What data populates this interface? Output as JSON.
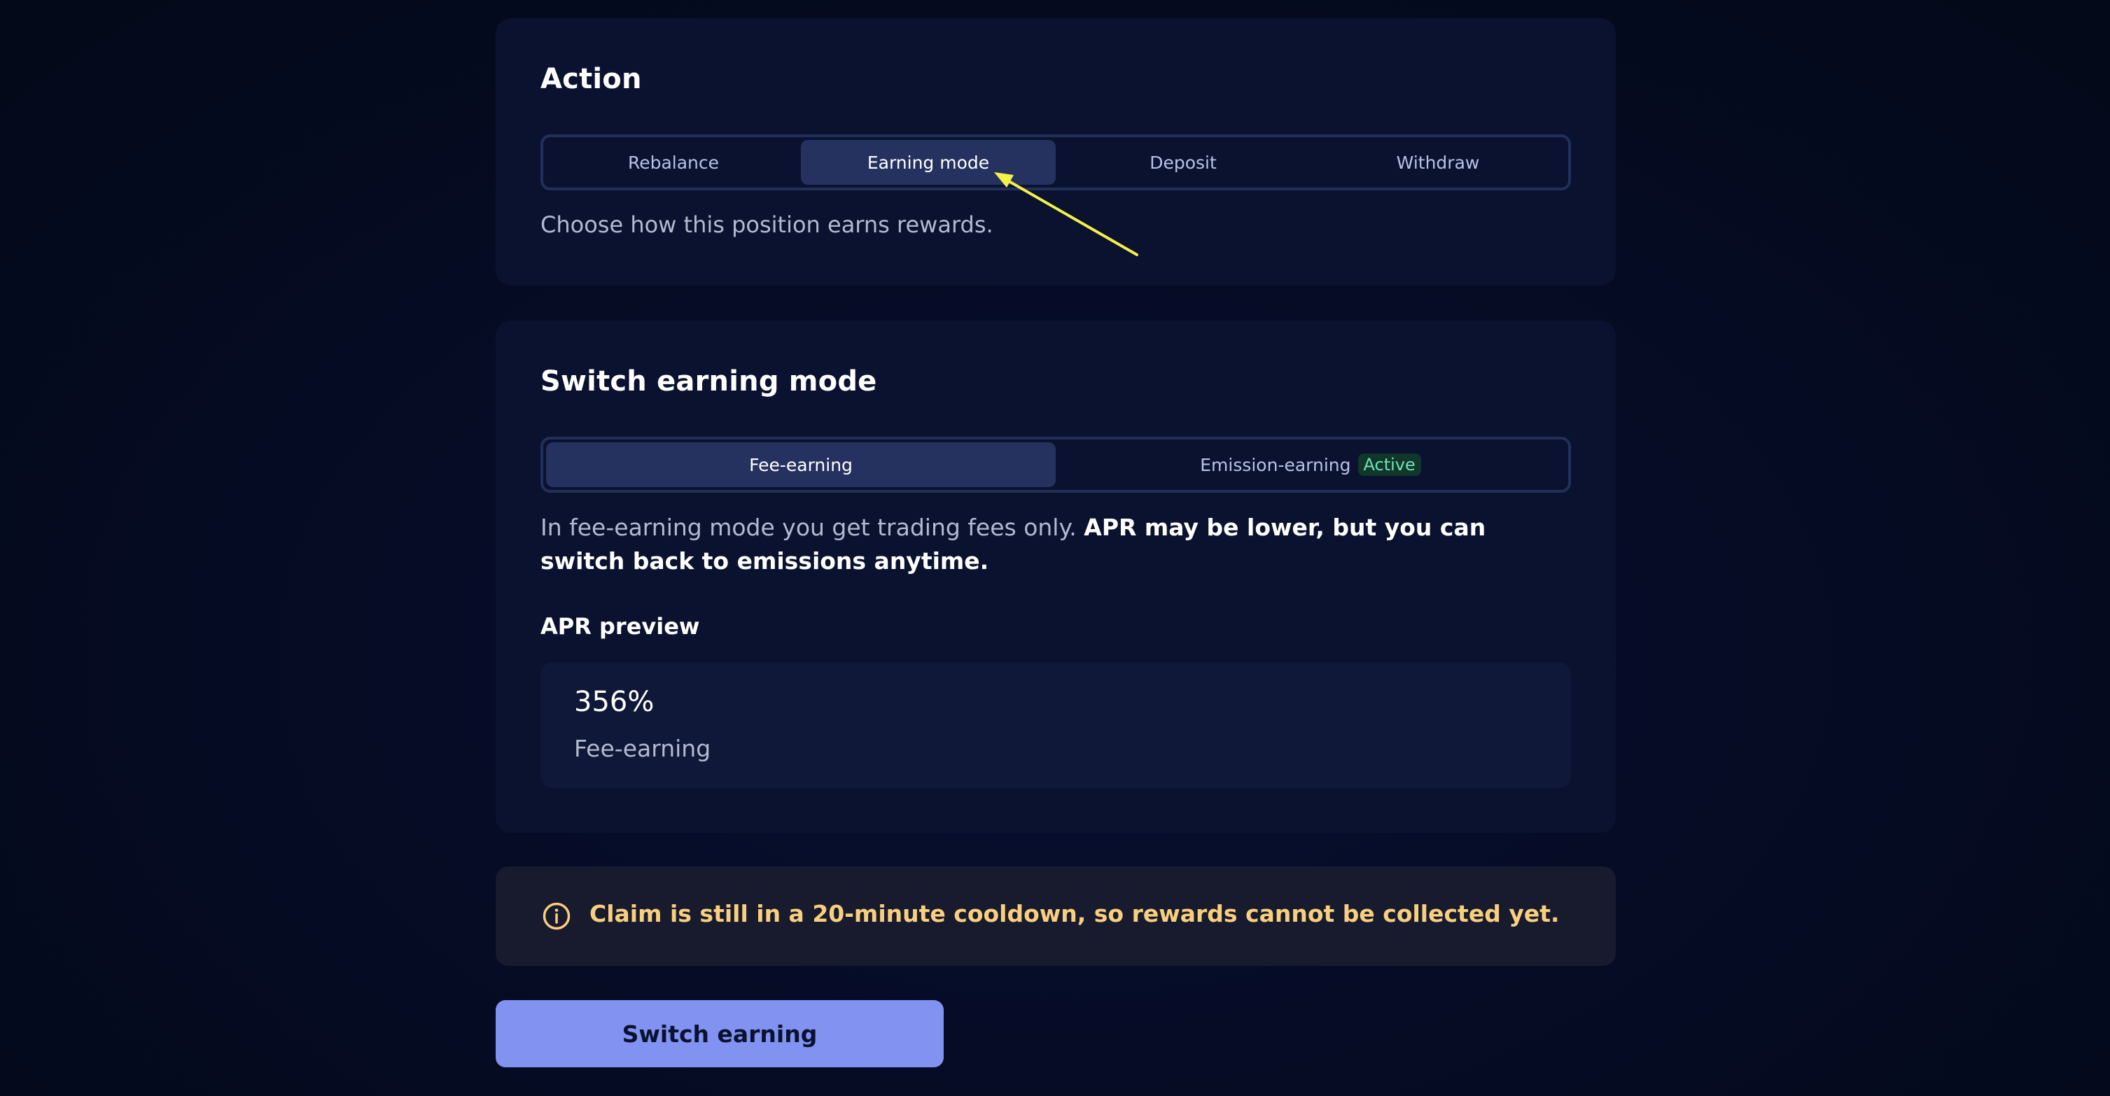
{
  "action_card": {
    "title": "Action",
    "tabs": [
      {
        "label": "Rebalance",
        "selected": false
      },
      {
        "label": "Earning mode",
        "selected": true
      },
      {
        "label": "Deposit",
        "selected": false
      },
      {
        "label": "Withdraw",
        "selected": false
      }
    ],
    "subtext": "Choose how this position earns rewards."
  },
  "switch_card": {
    "title": "Switch earning mode",
    "options": [
      {
        "label": "Fee-earning",
        "selected": true
      },
      {
        "label": "Emission-earning",
        "badge": "Active",
        "selected": false
      }
    ],
    "description_plain": "In fee-earning mode you get trading fees only. ",
    "description_bold": "APR may be lower, but you can switch back to emissions anytime.",
    "apr_label": "APR preview",
    "apr_value": "356%",
    "apr_mode": "Fee-earning"
  },
  "notice": {
    "icon": "info-icon",
    "text": "Claim is still in a 20-minute cooldown, so rewards cannot be collected yet.",
    "color": "#f8cf7e"
  },
  "primary_button": {
    "label": "Switch earning",
    "color": "#8192f0"
  },
  "annotation": {
    "icon": "pointer-arrow",
    "color": "#f4f14a"
  }
}
